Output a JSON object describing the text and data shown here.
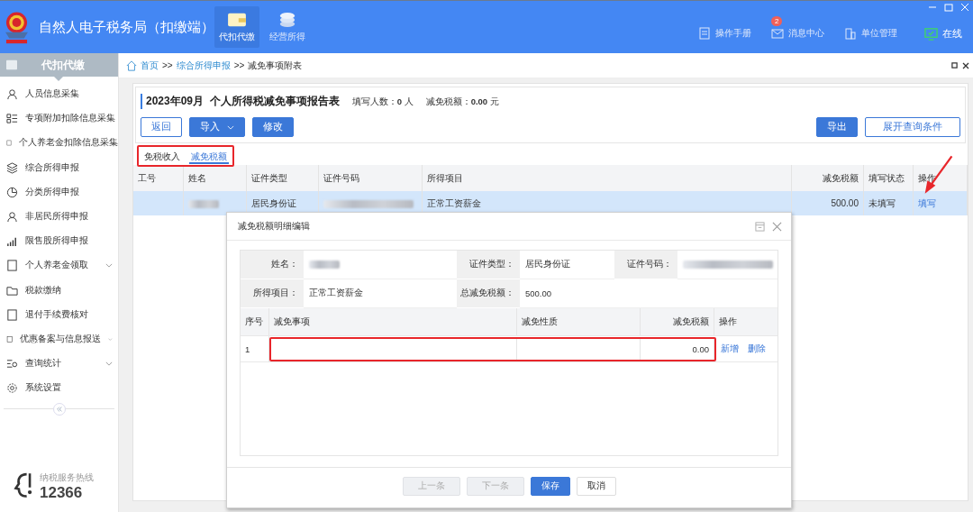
{
  "header": {
    "title": "自然人电子税务局（扣缴端）",
    "nav": [
      {
        "label": "代扣代缴",
        "selected": true
      },
      {
        "label": "经营所得",
        "selected": false
      }
    ],
    "tools": [
      {
        "label": "操作手册"
      },
      {
        "label": "消息中心",
        "badge": "2"
      },
      {
        "label": "单位管理"
      }
    ],
    "status": "在线"
  },
  "sidebar": {
    "title": "代扣代缴",
    "items": [
      {
        "label": "人员信息采集",
        "expandable": false
      },
      {
        "label": "专项附加扣除信息采集",
        "expandable": false
      },
      {
        "label": "个人养老金扣除信息采集",
        "expandable": false
      },
      {
        "label": "综合所得申报",
        "expandable": false
      },
      {
        "label": "分类所得申报",
        "expandable": false
      },
      {
        "label": "非居民所得申报",
        "expandable": false
      },
      {
        "label": "限售股所得申报",
        "expandable": false
      },
      {
        "label": "个人养老金领取",
        "expandable": true
      },
      {
        "label": "税款缴纳",
        "expandable": false
      },
      {
        "label": "退付手续费核对",
        "expandable": false
      },
      {
        "label": "优惠备案与信息报送",
        "expandable": true
      },
      {
        "label": "查询统计",
        "expandable": true
      },
      {
        "label": "系统设置",
        "expandable": false
      }
    ],
    "hotline_label": "纳税服务热线",
    "hotline": "12366"
  },
  "breadcrumb": [
    {
      "kind": "link",
      "text": "首页"
    },
    {
      "kind": "sep",
      "text": ">>"
    },
    {
      "kind": "link",
      "text": "综合所得申报"
    },
    {
      "kind": "sep",
      "text": ">>"
    },
    {
      "kind": "current",
      "text": "减免事项附表"
    }
  ],
  "report": {
    "title": "2023年09月  个人所得税减免事项报告表",
    "stats": [
      {
        "label": "填写人数：",
        "value": "0",
        "unit": "人"
      },
      {
        "label": "减免税额：",
        "value": "0.00",
        "unit": "元"
      }
    ],
    "left_buttons": [
      {
        "label": "返回",
        "kind": "outline",
        "dropdown": false
      },
      {
        "label": "导入",
        "kind": "primary",
        "dropdown": true
      },
      {
        "label": "修改",
        "kind": "primary",
        "dropdown": false
      }
    ],
    "right_buttons": [
      {
        "label": "导出",
        "kind": "primary",
        "dropdown": false
      },
      {
        "label": "展开查询条件",
        "kind": "outline",
        "dropdown": false
      }
    ]
  },
  "tabs": [
    {
      "label": "免税收入",
      "selected": false
    },
    {
      "label": "减免税额",
      "selected": true
    }
  ],
  "table": {
    "columns": [
      "工号",
      "姓名",
      "证件类型",
      "证件号码",
      "所得项目",
      "减免税额",
      "填写状态",
      "操作"
    ],
    "rows": [
      {
        "selected": true,
        "cells": [
          {
            "kind": "empty"
          },
          {
            "kind": "blurred"
          },
          {
            "kind": "text",
            "text": "居民身份证"
          },
          {
            "kind": "blurred"
          },
          {
            "kind": "text",
            "text": "正常工资薪金"
          },
          {
            "kind": "number",
            "text": "500.00"
          },
          {
            "kind": "text",
            "text": "未填写"
          },
          {
            "kind": "link",
            "text": "填写"
          }
        ]
      }
    ]
  },
  "dialog": {
    "title": "减免税额明细编辑",
    "fields": [
      {
        "label": "姓名：",
        "kind": "blurred"
      },
      {
        "label": "证件类型：",
        "kind": "text",
        "value": "居民身份证"
      },
      {
        "label": "证件号码：",
        "kind": "blurred"
      },
      {
        "label": "所得项目：",
        "kind": "text",
        "value": "正常工资薪金"
      },
      {
        "label": "总减免税额：",
        "kind": "text",
        "value": "500.00"
      }
    ],
    "columns": [
      "序号",
      "减免事项",
      "减免性质",
      "减免税额",
      "操作"
    ],
    "rows": [
      {
        "index": "1",
        "amount": "0.00",
        "actions": [
          "新增",
          "删除"
        ]
      }
    ],
    "buttons": [
      {
        "label": "上一条",
        "kind": "plain",
        "disabled": true
      },
      {
        "label": "下一条",
        "kind": "plain",
        "disabled": true
      },
      {
        "label": "保存",
        "kind": "primary",
        "disabled": false
      },
      {
        "label": "取消",
        "kind": "plain",
        "disabled": false
      }
    ]
  }
}
